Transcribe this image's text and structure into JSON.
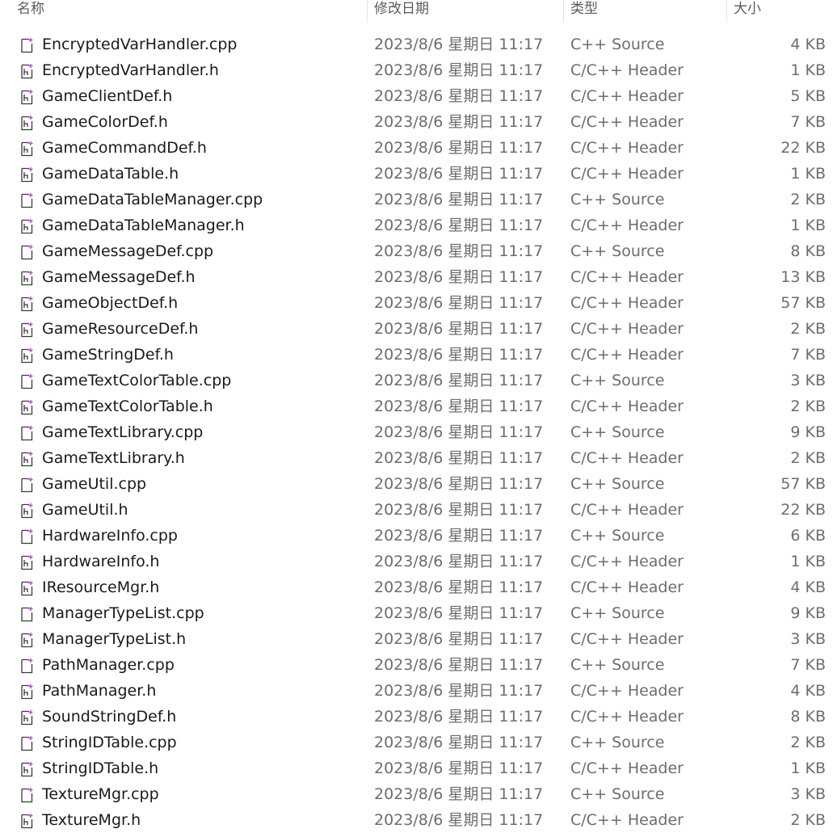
{
  "columns": {
    "name": "名称",
    "date": "修改日期",
    "type": "类型",
    "size": "大小"
  },
  "icons": {
    "cpp": "cpp-file-icon",
    "h": "header-file-icon"
  },
  "colors": {
    "icon_accent": "#b04fc6",
    "icon_stroke": "#3a3a3a",
    "hover": "#e5f3ff"
  },
  "files": [
    {
      "name": "EncryptedVarHandler.cpp",
      "date": "2023/8/6 星期日 11:17",
      "type": "C++ Source",
      "size": "4 KB",
      "kind": "cpp"
    },
    {
      "name": "EncryptedVarHandler.h",
      "date": "2023/8/6 星期日 11:17",
      "type": "C/C++ Header",
      "size": "1 KB",
      "kind": "h"
    },
    {
      "name": "GameClientDef.h",
      "date": "2023/8/6 星期日 11:17",
      "type": "C/C++ Header",
      "size": "5 KB",
      "kind": "h"
    },
    {
      "name": "GameColorDef.h",
      "date": "2023/8/6 星期日 11:17",
      "type": "C/C++ Header",
      "size": "7 KB",
      "kind": "h"
    },
    {
      "name": "GameCommandDef.h",
      "date": "2023/8/6 星期日 11:17",
      "type": "C/C++ Header",
      "size": "22 KB",
      "kind": "h"
    },
    {
      "name": "GameDataTable.h",
      "date": "2023/8/6 星期日 11:17",
      "type": "C/C++ Header",
      "size": "1 KB",
      "kind": "h"
    },
    {
      "name": "GameDataTableManager.cpp",
      "date": "2023/8/6 星期日 11:17",
      "type": "C++ Source",
      "size": "2 KB",
      "kind": "cpp"
    },
    {
      "name": "GameDataTableManager.h",
      "date": "2023/8/6 星期日 11:17",
      "type": "C/C++ Header",
      "size": "1 KB",
      "kind": "h"
    },
    {
      "name": "GameMessageDef.cpp",
      "date": "2023/8/6 星期日 11:17",
      "type": "C++ Source",
      "size": "8 KB",
      "kind": "cpp"
    },
    {
      "name": "GameMessageDef.h",
      "date": "2023/8/6 星期日 11:17",
      "type": "C/C++ Header",
      "size": "13 KB",
      "kind": "h"
    },
    {
      "name": "GameObjectDef.h",
      "date": "2023/8/6 星期日 11:17",
      "type": "C/C++ Header",
      "size": "57 KB",
      "kind": "h"
    },
    {
      "name": "GameResourceDef.h",
      "date": "2023/8/6 星期日 11:17",
      "type": "C/C++ Header",
      "size": "2 KB",
      "kind": "h"
    },
    {
      "name": "GameStringDef.h",
      "date": "2023/8/6 星期日 11:17",
      "type": "C/C++ Header",
      "size": "7 KB",
      "kind": "h"
    },
    {
      "name": "GameTextColorTable.cpp",
      "date": "2023/8/6 星期日 11:17",
      "type": "C++ Source",
      "size": "3 KB",
      "kind": "cpp"
    },
    {
      "name": "GameTextColorTable.h",
      "date": "2023/8/6 星期日 11:17",
      "type": "C/C++ Header",
      "size": "2 KB",
      "kind": "h"
    },
    {
      "name": "GameTextLibrary.cpp",
      "date": "2023/8/6 星期日 11:17",
      "type": "C++ Source",
      "size": "9 KB",
      "kind": "cpp"
    },
    {
      "name": "GameTextLibrary.h",
      "date": "2023/8/6 星期日 11:17",
      "type": "C/C++ Header",
      "size": "2 KB",
      "kind": "h"
    },
    {
      "name": "GameUtil.cpp",
      "date": "2023/8/6 星期日 11:17",
      "type": "C++ Source",
      "size": "57 KB",
      "kind": "cpp"
    },
    {
      "name": "GameUtil.h",
      "date": "2023/8/6 星期日 11:17",
      "type": "C/C++ Header",
      "size": "22 KB",
      "kind": "h"
    },
    {
      "name": "HardwareInfo.cpp",
      "date": "2023/8/6 星期日 11:17",
      "type": "C++ Source",
      "size": "6 KB",
      "kind": "cpp"
    },
    {
      "name": "HardwareInfo.h",
      "date": "2023/8/6 星期日 11:17",
      "type": "C/C++ Header",
      "size": "1 KB",
      "kind": "h"
    },
    {
      "name": "IResourceMgr.h",
      "date": "2023/8/6 星期日 11:17",
      "type": "C/C++ Header",
      "size": "4 KB",
      "kind": "h"
    },
    {
      "name": "ManagerTypeList.cpp",
      "date": "2023/8/6 星期日 11:17",
      "type": "C++ Source",
      "size": "9 KB",
      "kind": "cpp"
    },
    {
      "name": "ManagerTypeList.h",
      "date": "2023/8/6 星期日 11:17",
      "type": "C/C++ Header",
      "size": "3 KB",
      "kind": "h"
    },
    {
      "name": "PathManager.cpp",
      "date": "2023/8/6 星期日 11:17",
      "type": "C++ Source",
      "size": "7 KB",
      "kind": "cpp"
    },
    {
      "name": "PathManager.h",
      "date": "2023/8/6 星期日 11:17",
      "type": "C/C++ Header",
      "size": "4 KB",
      "kind": "h"
    },
    {
      "name": "SoundStringDef.h",
      "date": "2023/8/6 星期日 11:17",
      "type": "C/C++ Header",
      "size": "8 KB",
      "kind": "h"
    },
    {
      "name": "StringIDTable.cpp",
      "date": "2023/8/6 星期日 11:17",
      "type": "C++ Source",
      "size": "2 KB",
      "kind": "cpp"
    },
    {
      "name": "StringIDTable.h",
      "date": "2023/8/6 星期日 11:17",
      "type": "C/C++ Header",
      "size": "1 KB",
      "kind": "h"
    },
    {
      "name": "TextureMgr.cpp",
      "date": "2023/8/6 星期日 11:17",
      "type": "C++ Source",
      "size": "3 KB",
      "kind": "cpp"
    },
    {
      "name": "TextureMgr.h",
      "date": "2023/8/6 星期日 11:17",
      "type": "C/C++ Header",
      "size": "2 KB",
      "kind": "h"
    }
  ]
}
